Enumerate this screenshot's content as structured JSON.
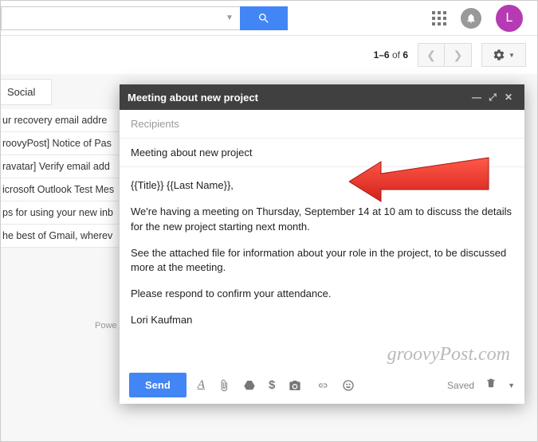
{
  "header": {
    "avatar_letter": "L"
  },
  "toolbar": {
    "page_range": "1–6",
    "page_of": "of",
    "page_total": "6"
  },
  "sidebar": {
    "tab_label": "Social",
    "items": [
      "ur recovery email addre",
      "roovyPost] Notice of Pas",
      "ravatar] Verify email add",
      "icrosoft Outlook Test Mes",
      "ps for using your new inb",
      "he best of Gmail, wherev"
    ],
    "powered": "Powe"
  },
  "compose": {
    "title": "Meeting about new project",
    "recipients_placeholder": "Recipients",
    "subject": "Meeting about new project",
    "body": {
      "greeting": "{{Title}} {{Last Name}},",
      "p1": "We're having a meeting on Thursday, September 14 at 10 am to discuss the details for the new project starting next month.",
      "p2": "See the attached file for information about your role in the project, to be discussed more at the meeting.",
      "p3": "Please respond to confirm your attendance.",
      "signature": "Lori Kaufman"
    },
    "send_label": "Send",
    "saved_label": "Saved"
  },
  "watermark": "groovyPost.com"
}
